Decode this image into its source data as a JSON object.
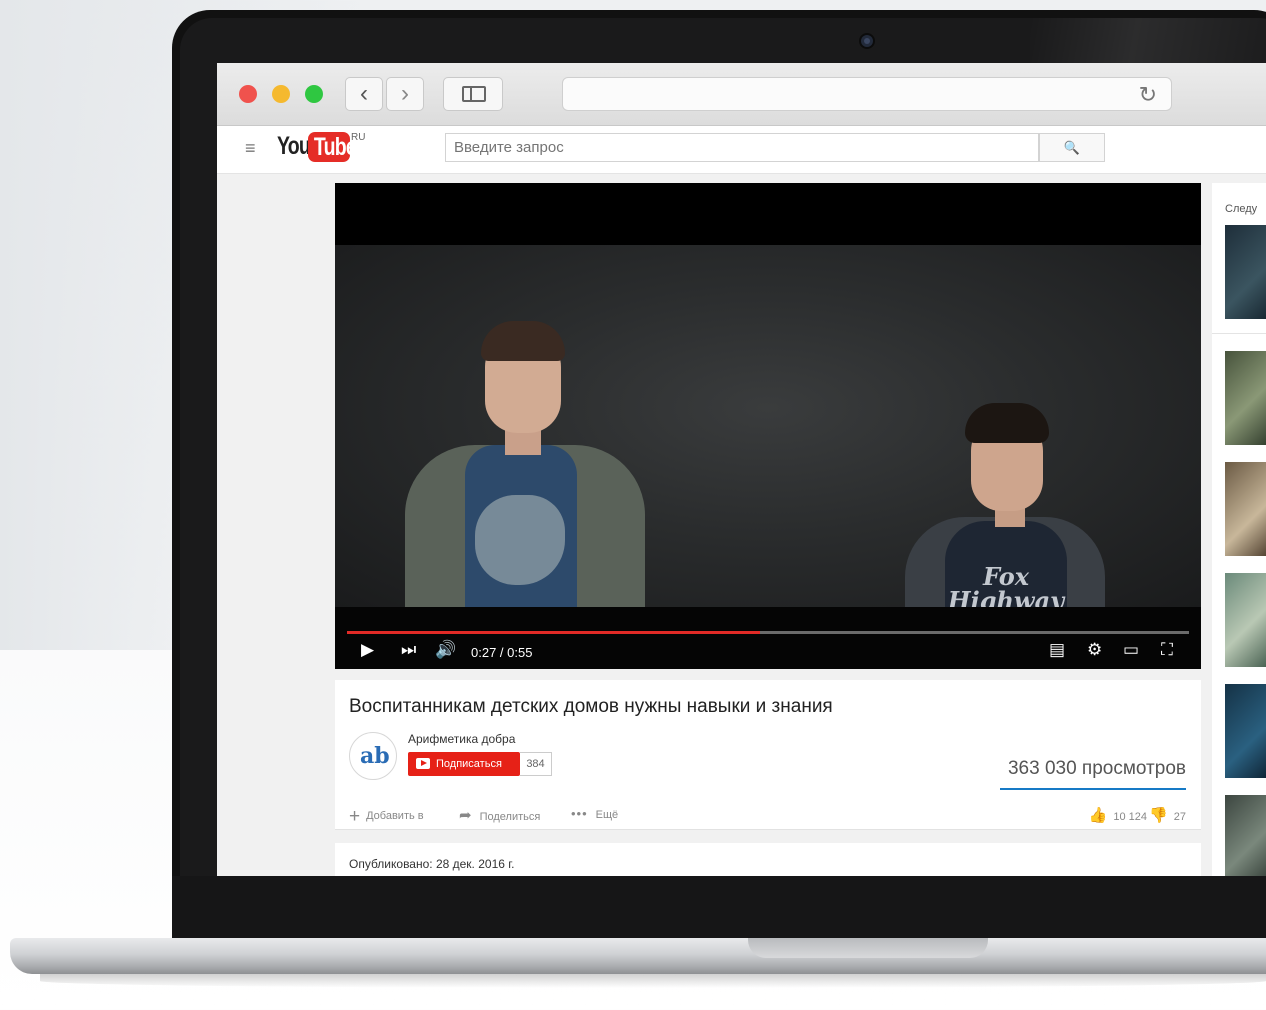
{
  "browser": {
    "back_glyph": "‹",
    "forward_glyph": "›",
    "reload_glyph": "↻",
    "traffic_colors": {
      "close": "#f0524d",
      "minimize": "#f5b92f",
      "zoom": "#2fc741"
    }
  },
  "youtube": {
    "menu_glyph": "≡",
    "logo_you": "You",
    "logo_tube": "Tube",
    "logo_region": "RU",
    "search_placeholder": "Введите запрос",
    "search_glyph": "🔍",
    "accent_color": "#e52d27"
  },
  "player": {
    "time": "0:27 / 0:55",
    "progress_fraction": 0.49,
    "shirt_text": "Fox Highway",
    "icons": {
      "play": "▶",
      "next": "⏭",
      "volume": "🔊",
      "subtitles": "▤",
      "settings": "⚙",
      "theater": "▭",
      "fullscreen": "⛶"
    }
  },
  "video": {
    "title": "Воспитанникам детских домов нужны навыки и знания",
    "channel_name": "Арифметика добра",
    "subscribe_label": "Подписаться",
    "subscriber_count": "384",
    "views": "363 030 просмотров",
    "actions": {
      "add_label": "Добавить в",
      "share_label": "Поделиться",
      "more_label": "Ещё",
      "plus_glyph": "+",
      "share_glyph": "➦",
      "more_glyph": "•••"
    },
    "likes": "10 124",
    "dislikes": "27",
    "like_glyph": "👍",
    "dislike_glyph": "👎",
    "published": "Опубликовано: 28 дек. 2016 г."
  },
  "sidebar": {
    "label": "Следу"
  }
}
